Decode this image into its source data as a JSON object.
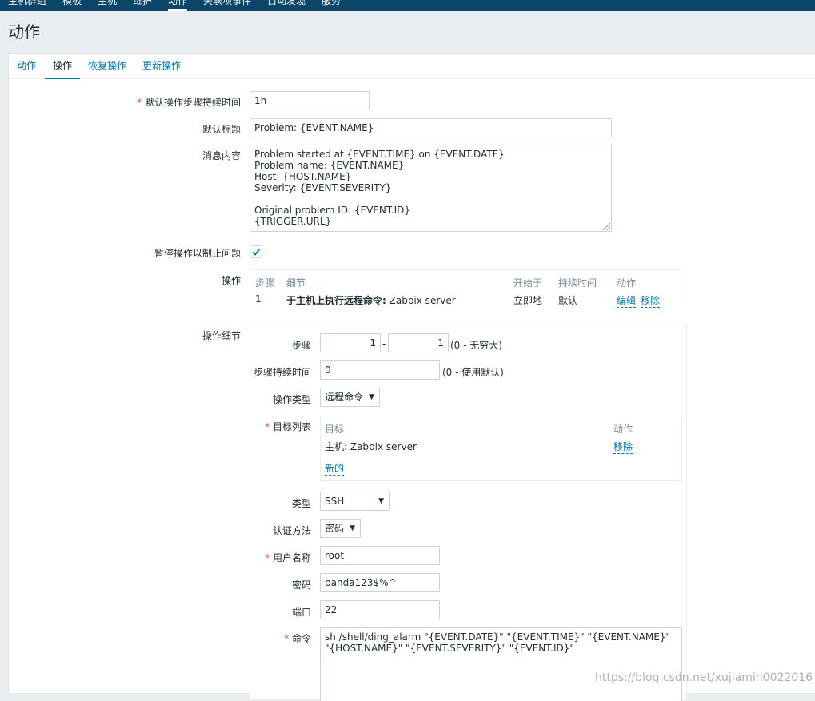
{
  "topnav": {
    "items": [
      "主机群组",
      "模板",
      "主机",
      "维护",
      "动作",
      "关联项事件",
      "自动发现",
      "服务"
    ],
    "active_index": 4
  },
  "page": {
    "title": "动作"
  },
  "tabs": [
    "动作",
    "操作",
    "恢复操作",
    "更新操作"
  ],
  "active_tab": 1,
  "form": {
    "default_step_duration": {
      "label": "默认操作步骤持续时间",
      "value": "1h"
    },
    "default_subject": {
      "label": "默认标题",
      "value": "Problem: {EVENT.NAME}"
    },
    "default_message": {
      "label": "消息内容",
      "value": "Problem started at {EVENT.TIME} on {EVENT.DATE}\nProblem name: {EVENT.NAME}\nHost: {HOST.NAME}\nSeverity: {EVENT.SEVERITY}\n\nOriginal problem ID: {EVENT.ID}\n{TRIGGER.URL}"
    },
    "pause_suppressed": {
      "label": "暂停操作以制止问题",
      "checked": true
    },
    "operations": {
      "label": "操作",
      "headers": [
        "步骤",
        "细节",
        "开始于",
        "持续时间",
        "动作"
      ],
      "rows": [
        {
          "step": "1",
          "detail_bold": "于主机上执行远程命令:",
          "detail_rest": " Zabbix server",
          "start": "立即地",
          "duration": "默认",
          "edit": "编辑",
          "remove": "移除"
        }
      ]
    },
    "operation_details": {
      "label": "操作细节",
      "steps": {
        "label": "步骤",
        "from": "1",
        "dash": "-",
        "to": "1",
        "note": "(0 - 无穷大)"
      },
      "step_duration": {
        "label": "步骤持续时间",
        "value": "0",
        "note": "(0 - 使用默认)"
      },
      "operation_type": {
        "label": "操作类型",
        "value": "远程命令"
      },
      "target_list": {
        "label": "目标列表",
        "headers": [
          "目标",
          "动作"
        ],
        "rows": [
          {
            "target": "主机: Zabbix server",
            "action": "移除"
          }
        ],
        "new_label": "新的"
      },
      "type": {
        "label": "类型",
        "value": "SSH"
      },
      "auth_method": {
        "label": "认证方法",
        "value": "密码"
      },
      "username": {
        "label": "用户名称",
        "value": "root"
      },
      "password": {
        "label": "密码",
        "value": "panda123$%^"
      },
      "port": {
        "label": "端口",
        "value": "22"
      },
      "command": {
        "label": "命令",
        "value": "sh /shell/ding_alarm \"{EVENT.DATE}\" \"{EVENT.TIME}\" \"{EVENT.NAME}\" \"{HOST.NAME}\" \"{EVENT.SEVERITY}\" \"{EVENT.ID}\""
      }
    }
  },
  "watermark": "https://blog.csdn.net/xujiamin0022016",
  "colors": {
    "nav_bg": "#0a466a",
    "link": "#0275b8",
    "required": "#d64e4e",
    "page_bg": "#ebeef0"
  },
  "icons": {
    "checkbox": "check-icon",
    "select": "caret-down-icon"
  }
}
